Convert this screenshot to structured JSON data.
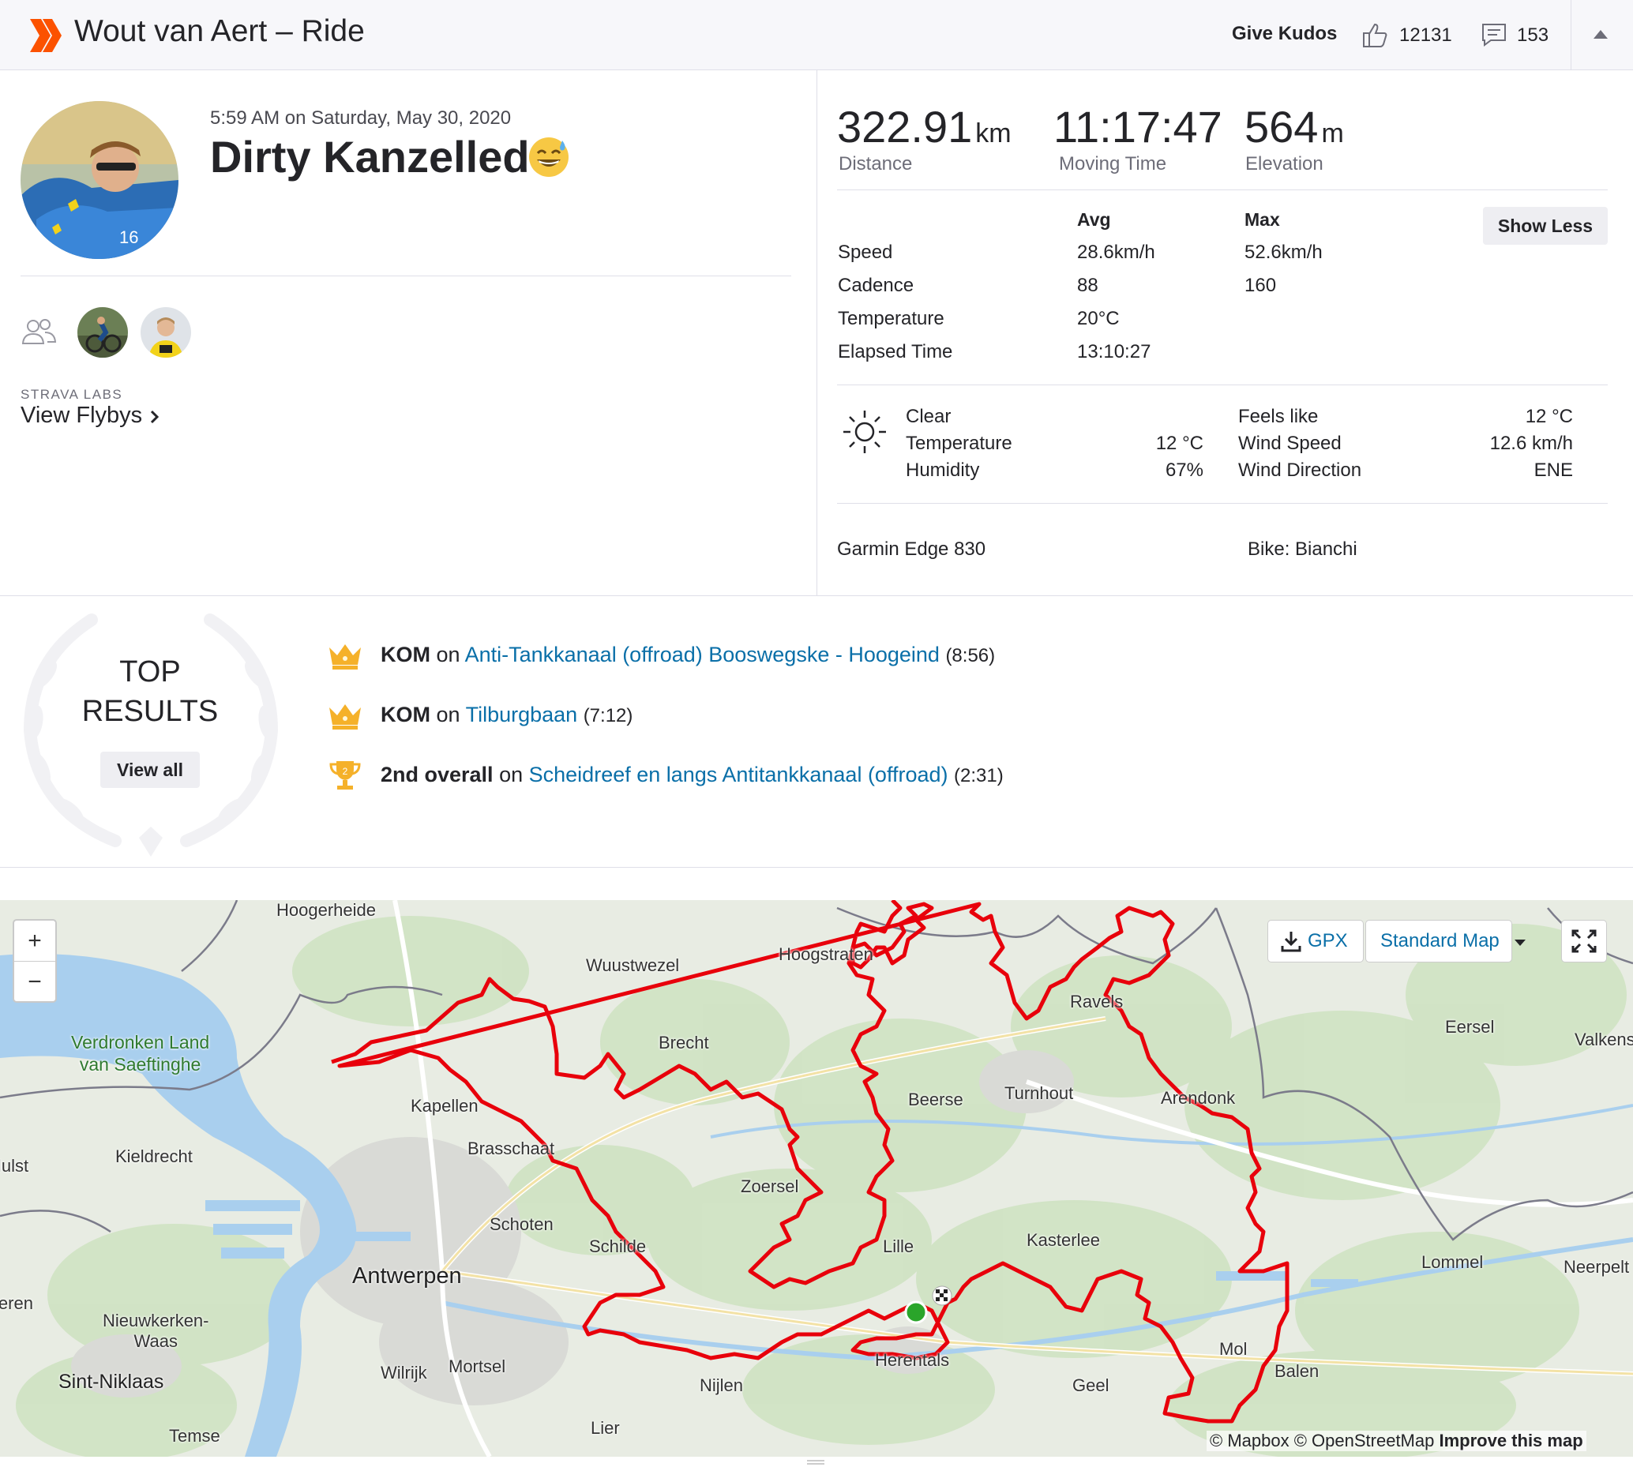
{
  "header": {
    "title": "Wout van Aert – Ride",
    "give_kudos": "Give Kudos",
    "kudos_count": "12131",
    "comment_count": "153"
  },
  "activity": {
    "date": "5:59 AM on Saturday, May 30, 2020",
    "name": "Dirty Kanzelled",
    "labs_caption": "STRAVA LABS",
    "view_flybys": "View Flybys"
  },
  "stats": {
    "primary": [
      {
        "value": "322.91",
        "unit": "km",
        "label": "Distance"
      },
      {
        "value": "11:17:47",
        "unit": "",
        "label": "Moving Time"
      },
      {
        "value": "564",
        "unit": "m",
        "label": "Elevation"
      }
    ],
    "header_avg": "Avg",
    "header_max": "Max",
    "show_less": "Show Less",
    "rows": [
      {
        "label": "Speed",
        "avg": "28.6km/h",
        "max": "52.6km/h"
      },
      {
        "label": "Cadence",
        "avg": "88",
        "max": "160"
      },
      {
        "label": "Temperature",
        "avg": "20°C",
        "max": ""
      },
      {
        "label": "Elapsed Time",
        "avg": "13:10:27",
        "max": ""
      }
    ]
  },
  "weather": {
    "condition": "Clear",
    "temperature_label": "Temperature",
    "temperature": "12 °C",
    "humidity_label": "Humidity",
    "humidity": "67%",
    "feels_like_label": "Feels like",
    "feels_like": "12 °C",
    "wind_speed_label": "Wind Speed",
    "wind_speed": "12.6 km/h",
    "wind_direction_label": "Wind Direction",
    "wind_direction": "ENE"
  },
  "gear": {
    "device": "Garmin Edge 830",
    "bike": "Bike: Bianchi"
  },
  "top_results": {
    "title_line1": "TOP",
    "title_line2": "RESULTS",
    "view_all": "View all",
    "items": [
      {
        "icon": "crown-icon",
        "rank": "KOM",
        "on": "on",
        "segment": "Anti-Tankkanaal (offroad) Booswegske - Hoogeind",
        "time": "(8:56)"
      },
      {
        "icon": "crown-icon",
        "rank": "KOM",
        "on": "on",
        "segment": "Tilburgbaan",
        "time": "(7:12)"
      },
      {
        "icon": "trophy-icon",
        "rank": "2nd overall",
        "on": "on",
        "segment": "Scheidreef en langs Antitankkanaal (offroad)",
        "time": "(2:31)"
      }
    ]
  },
  "map": {
    "zoom_in": "+",
    "zoom_out": "−",
    "gpx": "GPX",
    "map_style": "Standard Map",
    "attribution_mapbox": "© Mapbox",
    "attribution_osm": "© OpenStreetMap",
    "attribution_improve": "Improve this map",
    "labels": {
      "hoogerheide": "Hoogerheide",
      "wuustwezel": "Wuustwezel",
      "hoogstraten": "Hoogstraten",
      "ravels": "Ravels",
      "eersel": "Eersel",
      "valkens": "Valkens",
      "verdronken": "Verdronken Land",
      "saeftinghe": "van Saeftinghe",
      "brecht": "Brecht",
      "kapellen": "Kapellen",
      "beerse": "Beerse",
      "turnhout": "Turnhout",
      "arendonk": "Arendonk",
      "hulst": "Hulst",
      "kieldrecht": "Kieldrecht",
      "brasschaat": "Brasschaat",
      "zoersel": "Zoersel",
      "schoten": "Schoten",
      "schilde": "Schilde",
      "lille": "Lille",
      "kasterlee": "Kasterlee",
      "lommel": "Lommel",
      "neerpelt": "Neerpelt",
      "antwerpen": "Antwerpen",
      "beveren": "Beveren",
      "nieuwkerken": "Nieuwkerken-",
      "waas": "Waas",
      "herentals": "Herentals",
      "mol": "Mol",
      "balen": "Balen",
      "wilrijk": "Wilrijk",
      "mortsel": "Mortsel",
      "sintniklaas": "Sint-Niklaas",
      "nijlen": "Nijlen",
      "geel": "Geel",
      "temse": "Temse",
      "lier": "Lier"
    }
  },
  "colors": {
    "brand": "#fc5200",
    "link": "#0a6fa8",
    "route": "#e8000b",
    "crown": "#f5b12a"
  }
}
